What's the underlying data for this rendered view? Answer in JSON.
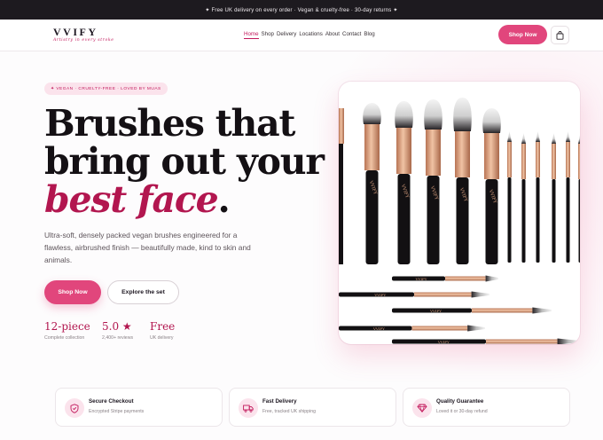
{
  "announcement": "✦ Free UK delivery on every order · Vegan & cruelty-free · 30-day returns ✦",
  "brand": {
    "name": "VVIFY",
    "tagline": "Artistry in every stroke"
  },
  "nav": {
    "links": [
      {
        "label": "Home",
        "active": true
      },
      {
        "label": "Shop",
        "active": false
      },
      {
        "label": "Delivery",
        "active": false
      },
      {
        "label": "Locations",
        "active": false
      },
      {
        "label": "About",
        "active": false
      },
      {
        "label": "Contact",
        "active": false
      },
      {
        "label": "Blog",
        "active": false
      }
    ],
    "cta": "Shop Now",
    "cart_icon": "shopping-bag-icon"
  },
  "hero": {
    "badge": "✦ VEGAN · CRUELTY-FREE · LOVED BY MUAS",
    "title_line1": "Brushes that",
    "title_line2": "bring out your",
    "title_em": "best face",
    "title_end": ".",
    "description": "Ultra-soft, densely packed vegan brushes engineered for a flawless, airbrushed finish — beautifully made, kind to skin and animals.",
    "primary_button": "Shop Now",
    "secondary_button": "Explore the set"
  },
  "stats": [
    {
      "value": "12-piece",
      "label": "Complete collection"
    },
    {
      "value": "5.0 ★",
      "label": "2,400+ reviews"
    },
    {
      "value": "Free",
      "label": "UK delivery"
    }
  ],
  "product_image": {
    "alt": "VVIFY brush set",
    "handle_text": "VVIFY"
  },
  "features": [
    {
      "icon": "shield-icon",
      "title": "Secure Checkout",
      "desc": "Encrypted Stripe payments"
    },
    {
      "icon": "truck-icon",
      "title": "Fast Delivery",
      "desc": "Free, tracked UK shipping"
    },
    {
      "icon": "diamond-icon",
      "title": "Quality Guarantee",
      "desc": "Loved it or 30-day refund"
    }
  ],
  "colors": {
    "accent": "#e1467c",
    "accent_dark": "#b2164f",
    "topbar": "#1d1a1f",
    "rose_gold": "#d9a07f"
  }
}
